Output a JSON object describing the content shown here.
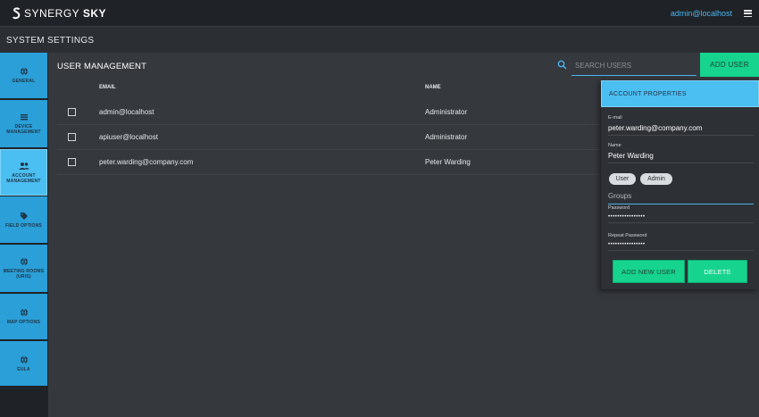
{
  "app": {
    "brand_light": "SYNERGY",
    "brand_bold": "SKY",
    "user": "admin@localhost",
    "accent": "#4bbef2",
    "success": "#16d48e"
  },
  "page": {
    "title": "SYSTEM SETTINGS"
  },
  "sidebar": {
    "items": [
      {
        "label": "GENERAL",
        "icon": "globe-icon"
      },
      {
        "label": "DEVICE MANAGEMENT",
        "icon": "list-icon"
      },
      {
        "label": "ACCOUNT MANAGEMENT",
        "icon": "users-icon",
        "active": true
      },
      {
        "label": "FIELD OPTIONS",
        "icon": "tag-icon"
      },
      {
        "label": "MEETING ROOMS (URIS)",
        "icon": "globe-icon"
      },
      {
        "label": "MAP OPTIONS",
        "icon": "globe-icon"
      },
      {
        "label": "EULA",
        "icon": "globe-icon"
      }
    ]
  },
  "main": {
    "title": "USER MANAGEMENT",
    "search_placeholder": "SEARCH USERS",
    "add_user_label": "ADD USER",
    "columns": {
      "email": "EMAIL",
      "name": "NAME"
    },
    "rows": [
      {
        "email": "admin@localhost",
        "name": "Administrator"
      },
      {
        "email": "apiuser@localhost",
        "name": "Administrator"
      },
      {
        "email": "peter.warding@company.com",
        "name": "Peter Warding"
      }
    ]
  },
  "panel": {
    "title": "ACCOUNT PROPERTIES",
    "email_label": "E-mail",
    "email_value": "peter.warding@company.com",
    "name_label": "Name",
    "name_value": "Peter Warding",
    "chips": [
      "User",
      "Admin"
    ],
    "groups_placeholder": "Groups",
    "password_label": "Password",
    "password_value": "••••••••••••••••",
    "repeat_password_label": "Repeat Password",
    "repeat_password_value": "••••••••••••••••",
    "add_new_user_label": "ADD NEW USER",
    "delete_label": "DELETE"
  }
}
